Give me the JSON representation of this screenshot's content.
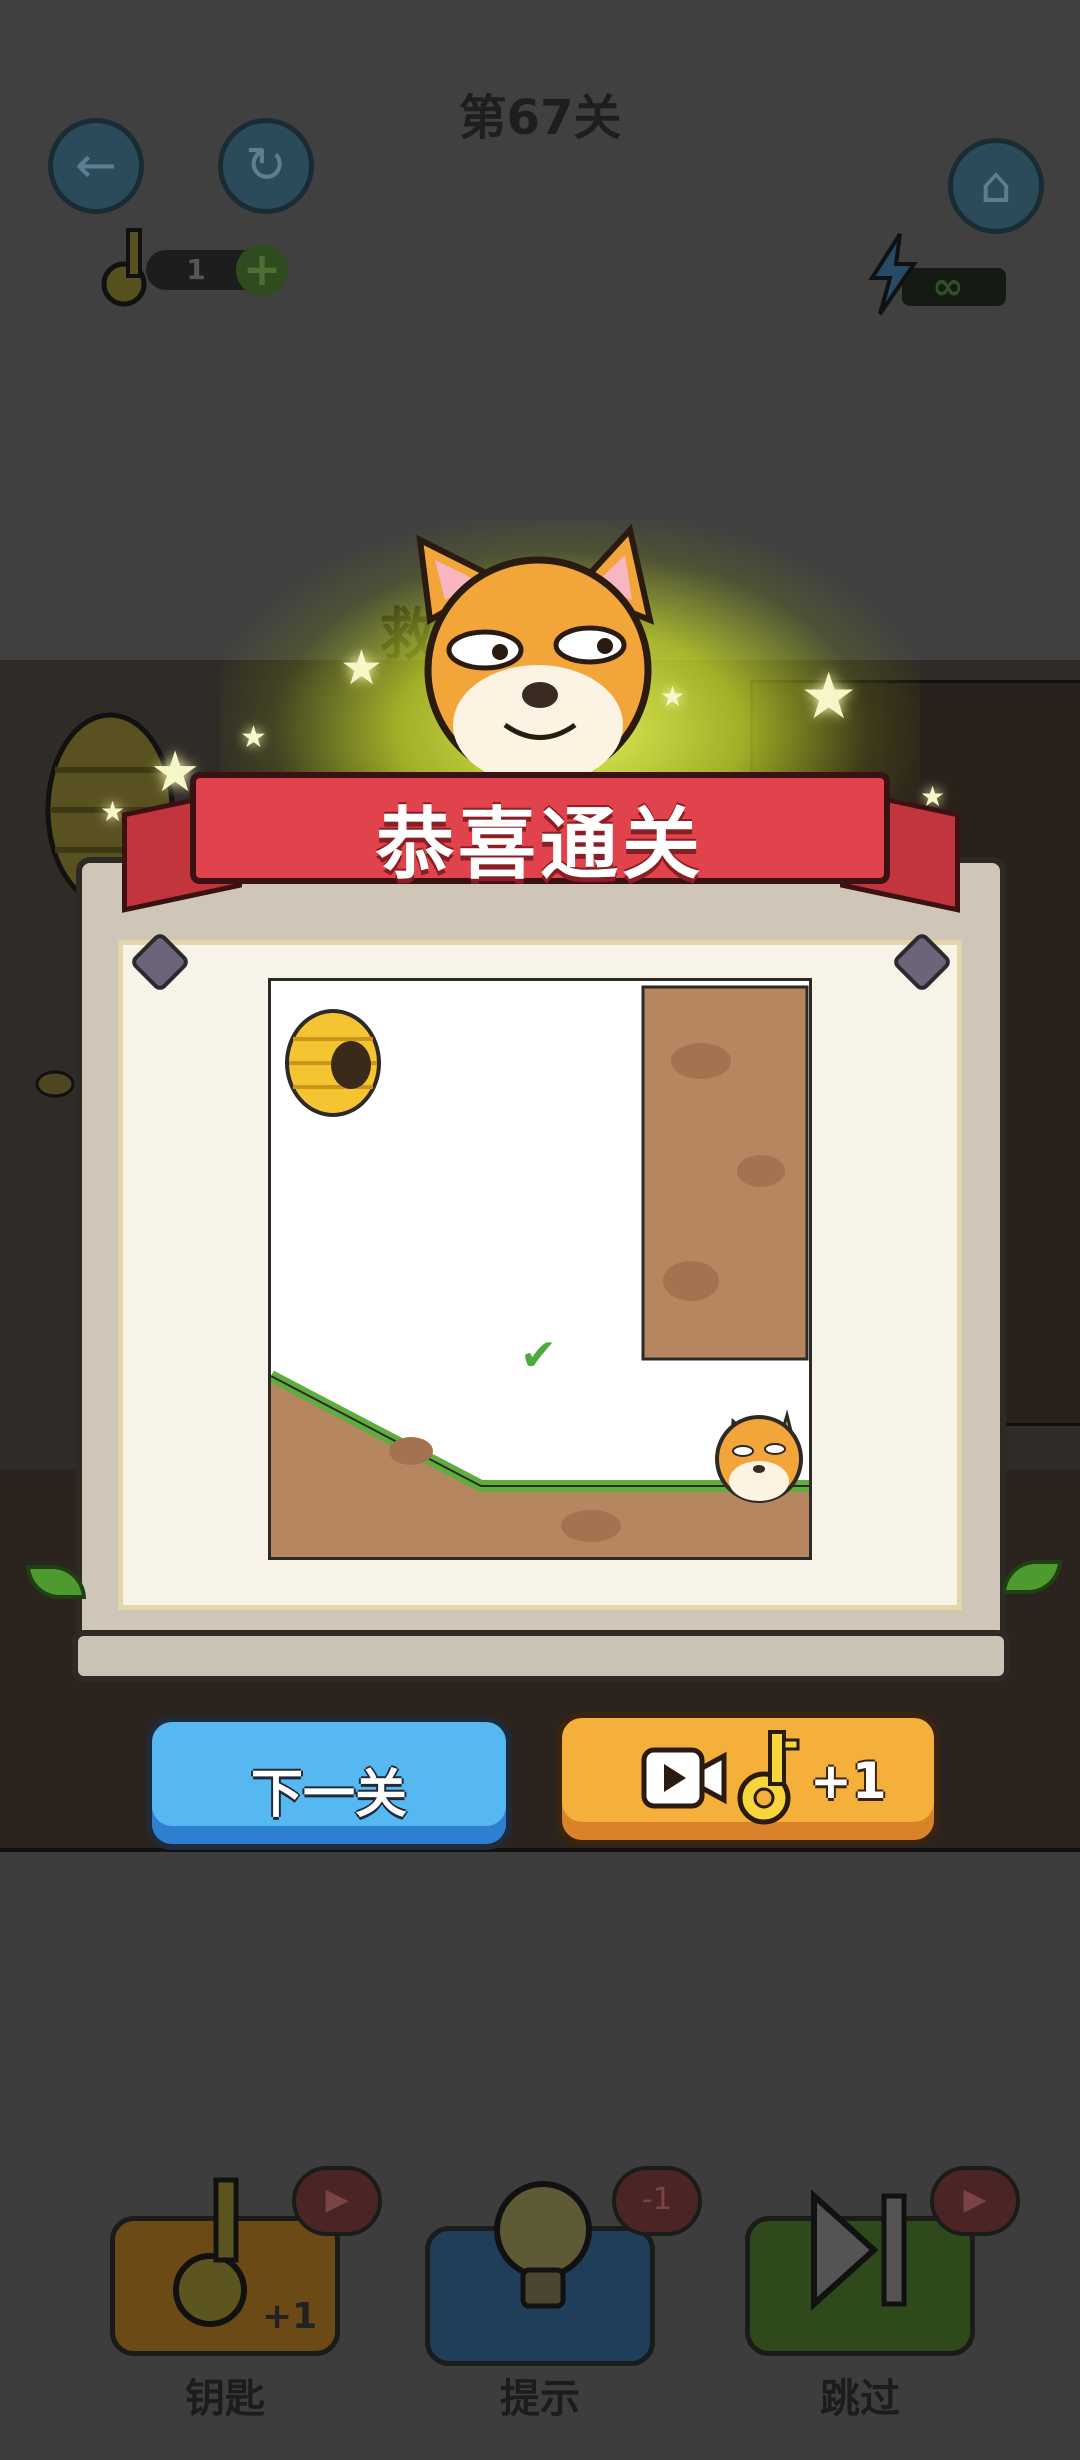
{
  "level": {
    "title": "第67关"
  },
  "hud": {
    "keys_count": "1",
    "keys_plus": "+",
    "energy": "∞"
  },
  "background": {
    "hint_fragment": "救"
  },
  "toolbar": {
    "items": [
      {
        "label": "钥匙",
        "badge": "",
        "reward": "+1"
      },
      {
        "label": "提示",
        "badge": "-1"
      },
      {
        "label": "跳过",
        "badge": ""
      }
    ]
  },
  "popup": {
    "banner": "恭喜通关",
    "next_button": "下一关",
    "video_reward": "+1"
  },
  "colors": {
    "banner": "#e0434b",
    "next_button": "#56b8f0",
    "video_button": "#f4b03a",
    "check": "#4daa3f"
  }
}
